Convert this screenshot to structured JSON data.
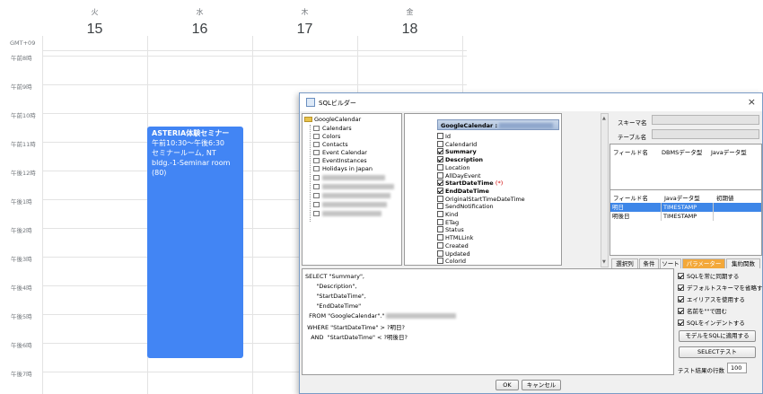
{
  "calendar": {
    "timezone": "GMT+09",
    "days": [
      {
        "dow": "火",
        "num": "15"
      },
      {
        "dow": "水",
        "num": "16"
      },
      {
        "dow": "木",
        "num": "17"
      },
      {
        "dow": "金",
        "num": "18"
      }
    ],
    "times": [
      "午前8時",
      "午前9時",
      "午前10時",
      "午前11時",
      "午後12時",
      "午後1時",
      "午後2時",
      "午後3時",
      "午後4時",
      "午後5時",
      "午後6時",
      "午後7時"
    ],
    "event": {
      "title": "ASTERIA体験セミナー",
      "time": "午前10:30～午後6:30",
      "location": "セミナールーム, NT bldg.-1-Seminar room (80)"
    },
    "accent_color": "#4285f4"
  },
  "dialog": {
    "title": "SQLビルダー",
    "close": "×",
    "tree": {
      "root": "GoogleCalendar",
      "items": [
        "Calendars",
        "Colors",
        "Contacts",
        "Event Calendar",
        "EventInstances",
        "Holidays in Japan"
      ]
    },
    "columns": {
      "table_header": "GoogleCalendar :",
      "rows": [
        {
          "label": "Id",
          "checked": false,
          "bold": false,
          "required": ""
        },
        {
          "label": "CalendarId",
          "checked": false,
          "bold": false,
          "required": ""
        },
        {
          "label": "Summary",
          "checked": true,
          "bold": true,
          "required": ""
        },
        {
          "label": "Description",
          "checked": true,
          "bold": true,
          "required": ""
        },
        {
          "label": "Location",
          "checked": false,
          "bold": false,
          "required": ""
        },
        {
          "label": "AllDayEvent",
          "checked": false,
          "bold": false,
          "required": ""
        },
        {
          "label": "StartDateTime",
          "checked": true,
          "bold": true,
          "required": "(*)"
        },
        {
          "label": "EndDateTime",
          "checked": true,
          "bold": true,
          "required": ""
        },
        {
          "label": "OriginalStartTimeDateTime",
          "checked": false,
          "bold": false,
          "required": ""
        },
        {
          "label": "SendNotification",
          "checked": false,
          "bold": false,
          "required": ""
        },
        {
          "label": "Kind",
          "checked": false,
          "bold": false,
          "required": ""
        },
        {
          "label": "ETag",
          "checked": false,
          "bold": false,
          "required": ""
        },
        {
          "label": "Status",
          "checked": false,
          "bold": false,
          "required": ""
        },
        {
          "label": "HTMLLink",
          "checked": false,
          "bold": false,
          "required": ""
        },
        {
          "label": "Created",
          "checked": false,
          "bold": false,
          "required": ""
        },
        {
          "label": "Updated",
          "checked": false,
          "bold": false,
          "required": ""
        },
        {
          "label": "ColorId",
          "checked": false,
          "bold": false,
          "required": ""
        }
      ]
    },
    "schema_label": "スキーマ名",
    "table_label": "テーブル名",
    "grid1_headers": [
      "フィールド名",
      "DBMSデータ型",
      "Javaデータ型"
    ],
    "grid2_headers": [
      "フィールド名",
      "Javaデータ型",
      "初期値"
    ],
    "grid2_rows": [
      {
        "field": "明日",
        "type": "TIMESTAMP",
        "init": ""
      },
      {
        "field": "明後日",
        "type": "TIMESTAMP",
        "init": ""
      }
    ],
    "tabs": [
      "選択列",
      "条件",
      "ソート",
      "パラメーター",
      "集約関数"
    ],
    "active_tab": "パラメーター",
    "sql_lines": [
      "SELECT \"Summary\",",
      "      \"Description\",",
      "      \"StartDateTime\",",
      "      \"EndDateTime\"",
      "  FROM \"GoogleCalendar\".\"",
      " WHERE \"StartDateTime\" > ?明日?",
      "   AND  \"StartDateTime\" < ?明後日?"
    ],
    "options": [
      {
        "label": "SQLを常に同期する",
        "checked": true
      },
      {
        "label": "デフォルトスキーマを省略する",
        "checked": true
      },
      {
        "label": "エイリアスを使用する",
        "checked": true
      },
      {
        "label": "名前を\"\"で囲む",
        "checked": true
      },
      {
        "label": "SQLをインデントする",
        "checked": true
      }
    ],
    "apply_button": "モデルをSQLに適用する",
    "test_button": "SELECTテスト",
    "result_rows_label": "テスト結果の行数",
    "result_rows_value": "100",
    "ok_button": "OK",
    "cancel_button": "キャンセル",
    "tab_active_color": "#f3a83a",
    "selected_row_color": "#3d86e8"
  }
}
